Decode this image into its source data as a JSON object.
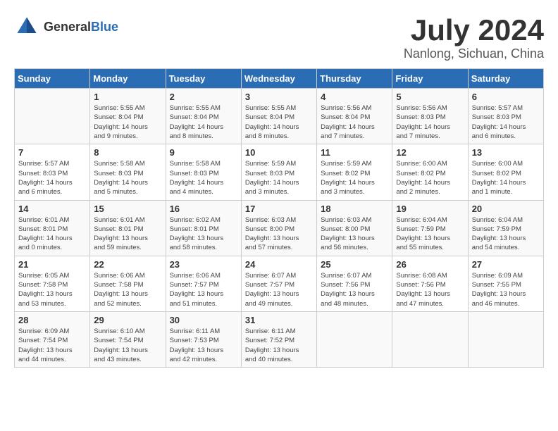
{
  "header": {
    "logo_general": "General",
    "logo_blue": "Blue",
    "month_year": "July 2024",
    "location": "Nanlong, Sichuan, China"
  },
  "days_of_week": [
    "Sunday",
    "Monday",
    "Tuesday",
    "Wednesday",
    "Thursday",
    "Friday",
    "Saturday"
  ],
  "weeks": [
    [
      {
        "day": "",
        "info": ""
      },
      {
        "day": "1",
        "info": "Sunrise: 5:55 AM\nSunset: 8:04 PM\nDaylight: 14 hours\nand 9 minutes."
      },
      {
        "day": "2",
        "info": "Sunrise: 5:55 AM\nSunset: 8:04 PM\nDaylight: 14 hours\nand 8 minutes."
      },
      {
        "day": "3",
        "info": "Sunrise: 5:55 AM\nSunset: 8:04 PM\nDaylight: 14 hours\nand 8 minutes."
      },
      {
        "day": "4",
        "info": "Sunrise: 5:56 AM\nSunset: 8:04 PM\nDaylight: 14 hours\nand 7 minutes."
      },
      {
        "day": "5",
        "info": "Sunrise: 5:56 AM\nSunset: 8:03 PM\nDaylight: 14 hours\nand 7 minutes."
      },
      {
        "day": "6",
        "info": "Sunrise: 5:57 AM\nSunset: 8:03 PM\nDaylight: 14 hours\nand 6 minutes."
      }
    ],
    [
      {
        "day": "7",
        "info": "Sunrise: 5:57 AM\nSunset: 8:03 PM\nDaylight: 14 hours\nand 6 minutes."
      },
      {
        "day": "8",
        "info": "Sunrise: 5:58 AM\nSunset: 8:03 PM\nDaylight: 14 hours\nand 5 minutes."
      },
      {
        "day": "9",
        "info": "Sunrise: 5:58 AM\nSunset: 8:03 PM\nDaylight: 14 hours\nand 4 minutes."
      },
      {
        "day": "10",
        "info": "Sunrise: 5:59 AM\nSunset: 8:03 PM\nDaylight: 14 hours\nand 3 minutes."
      },
      {
        "day": "11",
        "info": "Sunrise: 5:59 AM\nSunset: 8:02 PM\nDaylight: 14 hours\nand 3 minutes."
      },
      {
        "day": "12",
        "info": "Sunrise: 6:00 AM\nSunset: 8:02 PM\nDaylight: 14 hours\nand 2 minutes."
      },
      {
        "day": "13",
        "info": "Sunrise: 6:00 AM\nSunset: 8:02 PM\nDaylight: 14 hours\nand 1 minute."
      }
    ],
    [
      {
        "day": "14",
        "info": "Sunrise: 6:01 AM\nSunset: 8:01 PM\nDaylight: 14 hours\nand 0 minutes."
      },
      {
        "day": "15",
        "info": "Sunrise: 6:01 AM\nSunset: 8:01 PM\nDaylight: 13 hours\nand 59 minutes."
      },
      {
        "day": "16",
        "info": "Sunrise: 6:02 AM\nSunset: 8:01 PM\nDaylight: 13 hours\nand 58 minutes."
      },
      {
        "day": "17",
        "info": "Sunrise: 6:03 AM\nSunset: 8:00 PM\nDaylight: 13 hours\nand 57 minutes."
      },
      {
        "day": "18",
        "info": "Sunrise: 6:03 AM\nSunset: 8:00 PM\nDaylight: 13 hours\nand 56 minutes."
      },
      {
        "day": "19",
        "info": "Sunrise: 6:04 AM\nSunset: 7:59 PM\nDaylight: 13 hours\nand 55 minutes."
      },
      {
        "day": "20",
        "info": "Sunrise: 6:04 AM\nSunset: 7:59 PM\nDaylight: 13 hours\nand 54 minutes."
      }
    ],
    [
      {
        "day": "21",
        "info": "Sunrise: 6:05 AM\nSunset: 7:58 PM\nDaylight: 13 hours\nand 53 minutes."
      },
      {
        "day": "22",
        "info": "Sunrise: 6:06 AM\nSunset: 7:58 PM\nDaylight: 13 hours\nand 52 minutes."
      },
      {
        "day": "23",
        "info": "Sunrise: 6:06 AM\nSunset: 7:57 PM\nDaylight: 13 hours\nand 51 minutes."
      },
      {
        "day": "24",
        "info": "Sunrise: 6:07 AM\nSunset: 7:57 PM\nDaylight: 13 hours\nand 49 minutes."
      },
      {
        "day": "25",
        "info": "Sunrise: 6:07 AM\nSunset: 7:56 PM\nDaylight: 13 hours\nand 48 minutes."
      },
      {
        "day": "26",
        "info": "Sunrise: 6:08 AM\nSunset: 7:56 PM\nDaylight: 13 hours\nand 47 minutes."
      },
      {
        "day": "27",
        "info": "Sunrise: 6:09 AM\nSunset: 7:55 PM\nDaylight: 13 hours\nand 46 minutes."
      }
    ],
    [
      {
        "day": "28",
        "info": "Sunrise: 6:09 AM\nSunset: 7:54 PM\nDaylight: 13 hours\nand 44 minutes."
      },
      {
        "day": "29",
        "info": "Sunrise: 6:10 AM\nSunset: 7:54 PM\nDaylight: 13 hours\nand 43 minutes."
      },
      {
        "day": "30",
        "info": "Sunrise: 6:11 AM\nSunset: 7:53 PM\nDaylight: 13 hours\nand 42 minutes."
      },
      {
        "day": "31",
        "info": "Sunrise: 6:11 AM\nSunset: 7:52 PM\nDaylight: 13 hours\nand 40 minutes."
      },
      {
        "day": "",
        "info": ""
      },
      {
        "day": "",
        "info": ""
      },
      {
        "day": "",
        "info": ""
      }
    ]
  ]
}
